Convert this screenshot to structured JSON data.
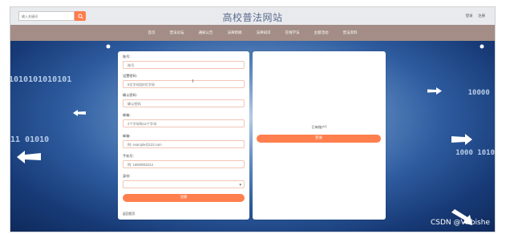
{
  "header": {
    "search_placeholder": "输入关键词",
    "site_title": "高校普法网站",
    "login_label": "登录",
    "register_label": "注册"
  },
  "nav": {
    "items": [
      {
        "label": "首页"
      },
      {
        "label": "普法论坛"
      },
      {
        "label": "通知公告"
      },
      {
        "label": "法律新闻"
      },
      {
        "label": "法律知识"
      },
      {
        "label": "在线学法"
      },
      {
        "label": "主题活动"
      },
      {
        "label": "普法资料"
      }
    ]
  },
  "hero": {
    "binary_left": "1010101010101",
    "binary_left2": "11 01010",
    "binary_right": "10000 10",
    "binary_right2": "1000 1010"
  },
  "register_form": {
    "account": {
      "label": "账号:",
      "placeholder": "账号"
    },
    "password": {
      "label": "设置密码:",
      "placeholder": "6位字母加0位字母"
    },
    "confirm_password": {
      "label": "确认密码:",
      "placeholder": "确认密码"
    },
    "email_code": {
      "label": "邮箱:",
      "placeholder": "2个字母和12个字母"
    },
    "email": {
      "label": "邮箱:",
      "placeholder": "例: example@123.com"
    },
    "phone": {
      "label": "手机号:",
      "placeholder": "例: 16660952312"
    },
    "identity": {
      "label": "身份:",
      "value": ""
    },
    "submit_label": "注册",
    "back_link": "返回首页"
  },
  "login_side": {
    "have_account_text": "已有账户?",
    "login_button": "登录"
  },
  "watermark": "CSDN @VXbishe",
  "colors": {
    "accent": "#ff7f4e",
    "nav_bg": "#a38d86",
    "topbar_bg": "#e9eaee",
    "title_color": "#5a6a8c"
  }
}
